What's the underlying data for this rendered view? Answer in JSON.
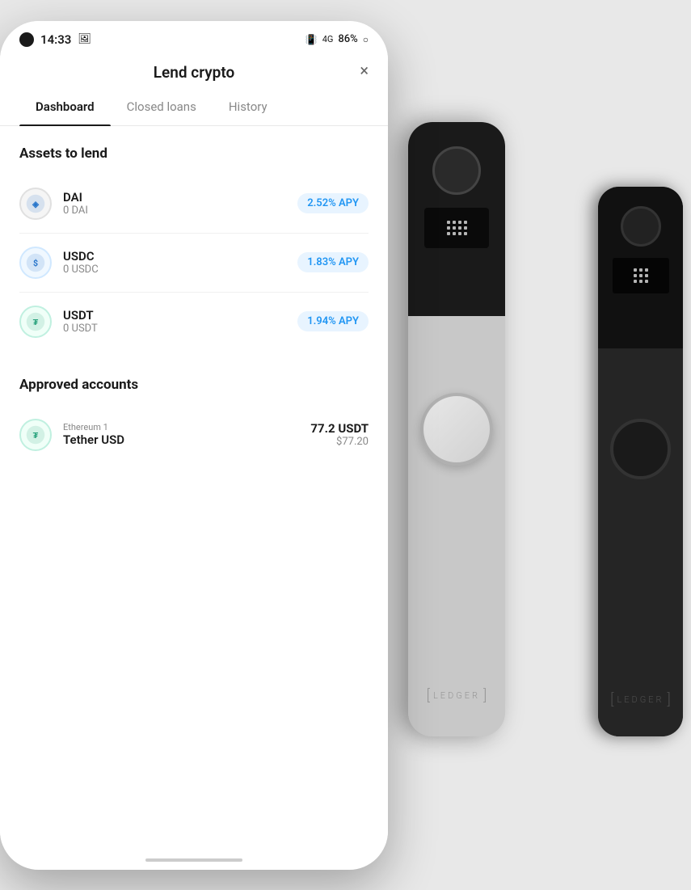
{
  "statusBar": {
    "time": "14:33",
    "battery": "86%"
  },
  "header": {
    "title": "Lend crypto",
    "close_label": "×"
  },
  "tabs": [
    {
      "id": "dashboard",
      "label": "Dashboard",
      "active": true
    },
    {
      "id": "closed-loans",
      "label": "Closed loans",
      "active": false
    },
    {
      "id": "history",
      "label": "History",
      "active": false
    }
  ],
  "assetsSection": {
    "title": "Assets to lend",
    "items": [
      {
        "symbol": "DAI",
        "balance": "0 DAI",
        "apy": "2.52% APY"
      },
      {
        "symbol": "USDC",
        "balance": "0 USDC",
        "apy": "1.83% APY"
      },
      {
        "symbol": "USDT",
        "balance": "0 USDT",
        "apy": "1.94% APY"
      }
    ]
  },
  "approvedSection": {
    "title": "Approved accounts",
    "items": [
      {
        "account": "Ethereum 1",
        "name": "Tether USD",
        "amount": "77.2 USDT",
        "usd": "$77.20"
      }
    ]
  },
  "ledger": {
    "logo": "LEDGER"
  }
}
